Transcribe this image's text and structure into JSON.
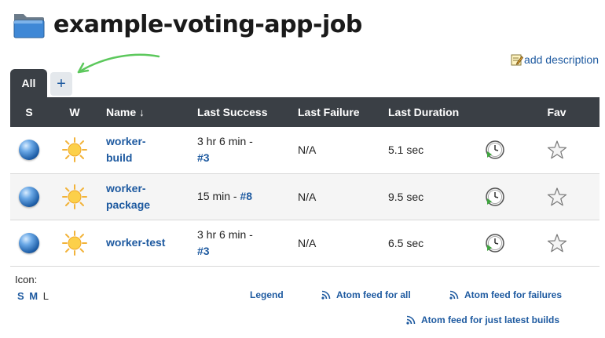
{
  "header": {
    "title": "example-voting-app-job",
    "folder_icon": "folder-icon"
  },
  "actions": {
    "add_description": "add description"
  },
  "tabs": {
    "all_label": "All",
    "add_label": "+"
  },
  "table": {
    "columns": {
      "s": "S",
      "w": "W",
      "name": "Name ↓",
      "last_success": "Last Success",
      "last_failure": "Last Failure",
      "last_duration": "Last Duration",
      "fav": "Fav"
    },
    "rows": [
      {
        "name_line1": "worker-",
        "name_line2": "build",
        "success_text": "3 hr 6 min -",
        "success_build": "#3",
        "failure": "N/A",
        "duration": "5.1 sec"
      },
      {
        "name_line1": "worker-",
        "name_line2": "package",
        "success_text": "15 min -",
        "success_build": "#8",
        "failure": "N/A",
        "duration": "9.5 sec"
      },
      {
        "name_line1": "worker-test",
        "name_line2": "",
        "success_text": "3 hr 6 min -",
        "success_build": "#3",
        "failure": "N/A",
        "duration": "6.5 sec"
      }
    ]
  },
  "footer": {
    "icon_label": "Icon:",
    "sizes": [
      "S",
      "M",
      "L"
    ],
    "legend": "Legend",
    "feed_all": "Atom feed for all",
    "feed_failures": "Atom feed for failures",
    "feed_latest": "Atom feed for just latest builds"
  },
  "colors": {
    "header_bg": "#3a3f45",
    "link": "#1e5aa0",
    "arrow": "#5cc85c"
  }
}
